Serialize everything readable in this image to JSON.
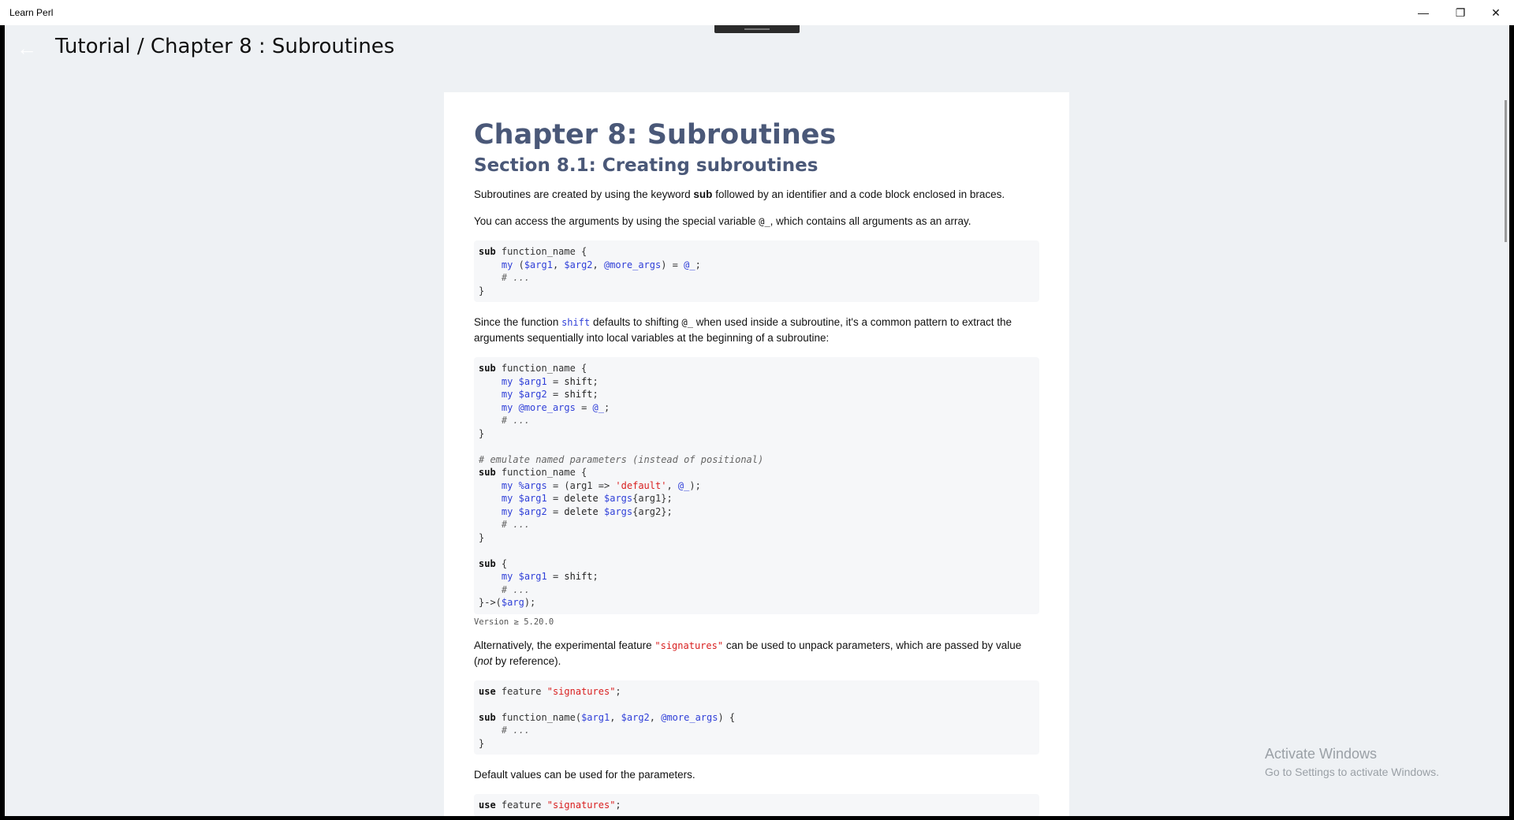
{
  "window": {
    "title": "Learn Perl",
    "minimize_glyph": "—",
    "maximize_glyph": "❐",
    "close_glyph": "✕"
  },
  "header": {
    "back_glyph": "←",
    "title": "Tutorial / Chapter 8 :  Subroutines"
  },
  "article": {
    "chapter_title": "Chapter 8: Subroutines",
    "section_title": "Section 8.1: Creating subroutines",
    "p1": {
      "before": "Subroutines are created by using the keyword ",
      "keyword": "sub",
      "after": " followed by an identifier and a code block enclosed in braces."
    },
    "p2": {
      "before": "You can access the arguments by using the special variable ",
      "code": "@_",
      "after": ", which contains all arguments as an array."
    },
    "p3": {
      "before": "Since the function ",
      "code1": "shift",
      "middle": " defaults to shifting ",
      "code2": "@_",
      "after": " when used inside a subroutine, it's a common pattern to extract the arguments sequentially into local variables at the beginning of a subroutine:"
    },
    "version_note": "Version ≥ 5.20.0",
    "p4": {
      "before": "Alternatively, the experimental feature ",
      "code": "\"signatures\"",
      "middle": " can be used to unpack parameters, which are passed by value (",
      "emph": "not",
      "after": " by reference)."
    },
    "p5": "Default values can be used for the parameters."
  },
  "watermark": {
    "line1": "Activate Windows",
    "line2": "Go to Settings to activate Windows."
  }
}
